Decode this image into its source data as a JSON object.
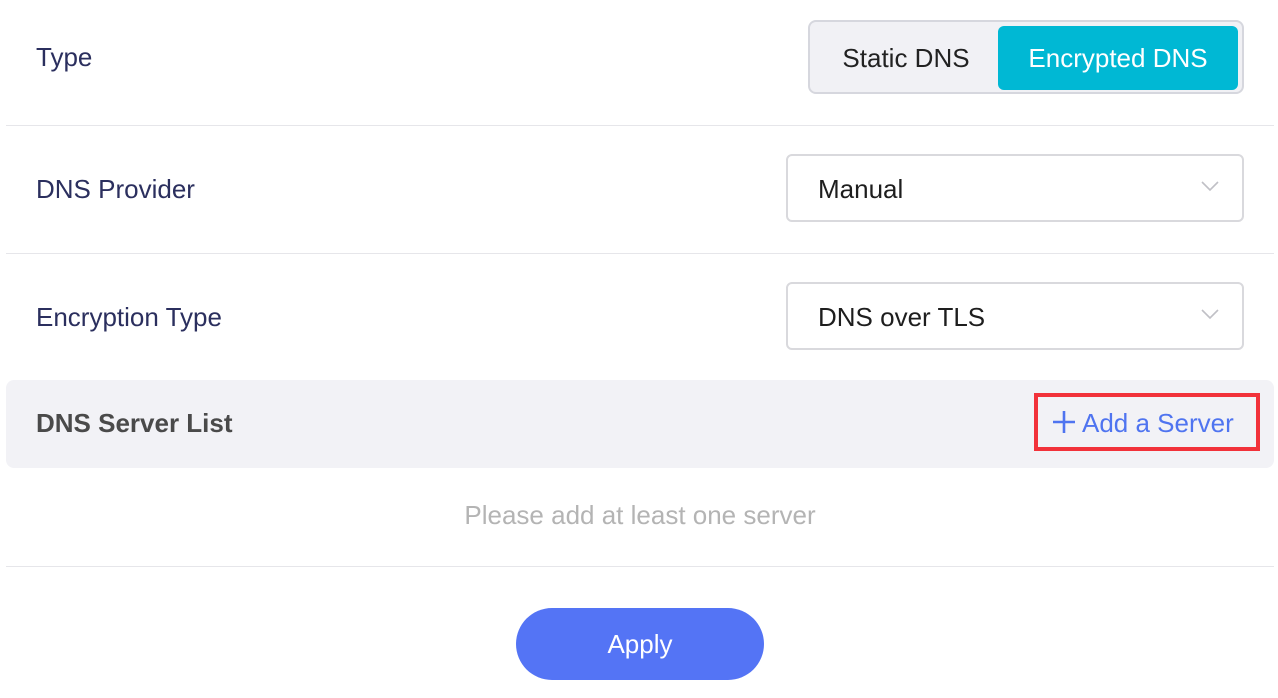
{
  "type_row": {
    "label": "Type",
    "options": [
      "Static DNS",
      "Encrypted DNS"
    ],
    "selected": "Encrypted DNS",
    "selected_color": "#00b8d4"
  },
  "provider_row": {
    "label": "DNS Provider",
    "value": "Manual",
    "icon": "chevron-down-icon"
  },
  "encryption_row": {
    "label": "Encryption Type",
    "value": "DNS over TLS",
    "icon": "chevron-down-icon"
  },
  "server_list": {
    "title": "DNS Server List",
    "add_label": "Add a Server",
    "add_icon": "plus-icon",
    "add_color": "#4f74f0",
    "highlight_color": "#f2323a",
    "empty_text": "Please add at least one server"
  },
  "apply": {
    "label": "Apply",
    "color": "#5474f5"
  }
}
